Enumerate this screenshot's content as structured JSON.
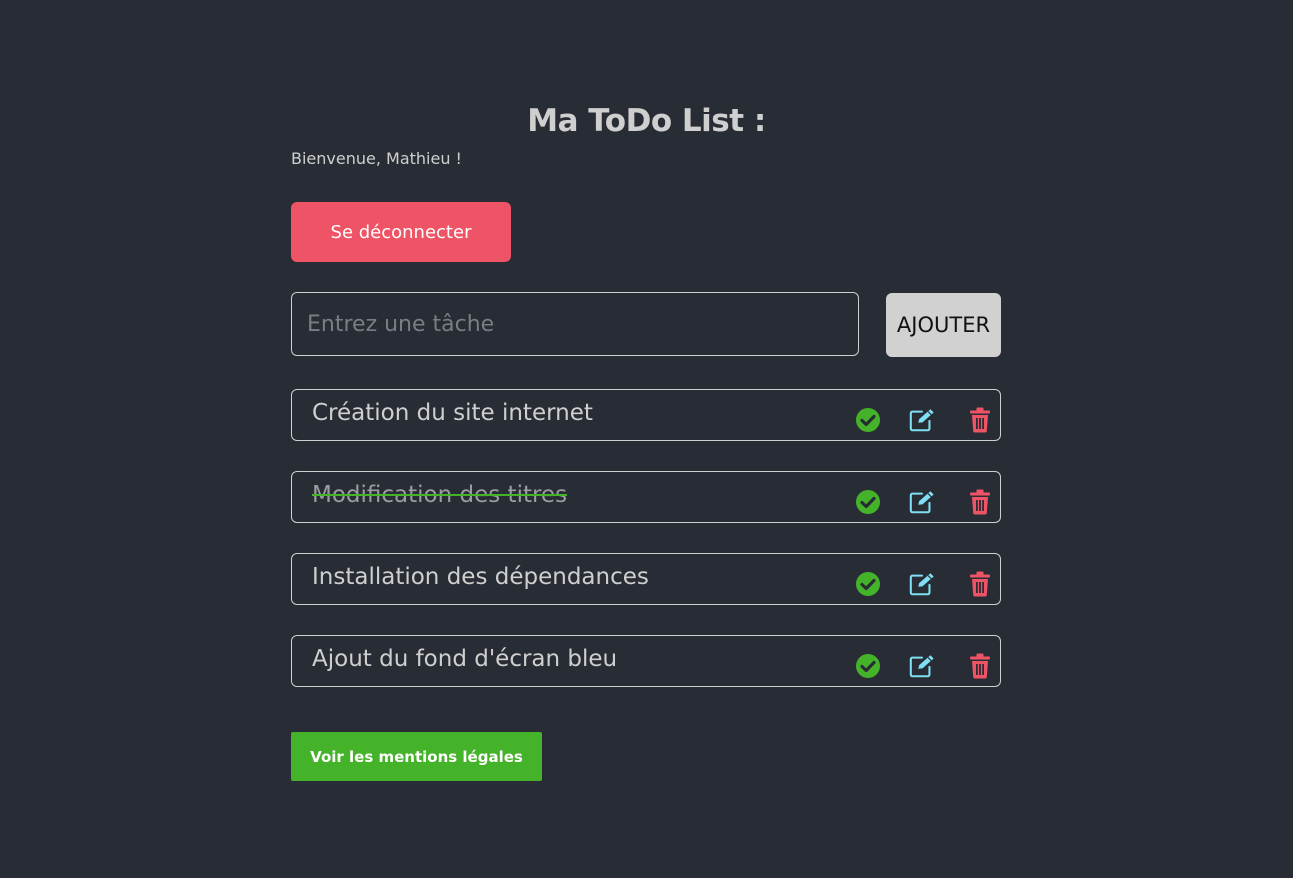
{
  "header": {
    "title": "Ma ToDo List :",
    "welcome": "Bienvenue, Mathieu !"
  },
  "auth": {
    "logout_label": "Se déconnecter"
  },
  "form": {
    "placeholder": "Entrez une tâche",
    "value": "",
    "add_label": "AJOUTER"
  },
  "tasks": [
    {
      "text": "Création du site internet",
      "completed": false
    },
    {
      "text": "Modification des titres",
      "completed": true
    },
    {
      "text": "Installation des dépendances",
      "completed": false
    },
    {
      "text": "Ajout du fond d'écran bleu",
      "completed": false
    }
  ],
  "task_icons": [
    "check-circle-icon",
    "edit-icon",
    "trash-icon"
  ],
  "footer": {
    "legal_label": "Voir les mentions légales"
  },
  "colors": {
    "background": "#282c34",
    "logout": "#ef5466",
    "add_button": "#d1d1d1",
    "check": "#44b32a",
    "edit": "#7ee0f2",
    "trash": "#ef5466",
    "legal": "#44b32a"
  }
}
